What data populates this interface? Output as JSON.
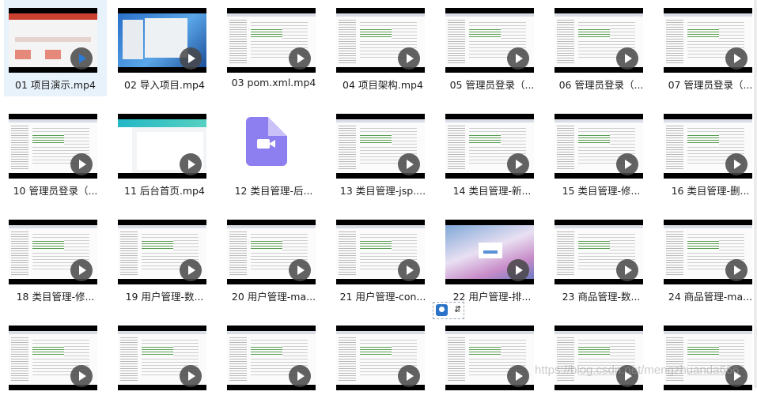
{
  "file_grid": {
    "items": [
      {
        "label": "01 项目演示.mp4",
        "thumb": "web",
        "selected": true
      },
      {
        "label": "02 导入项目.mp4",
        "thumb": "win"
      },
      {
        "label": "03 pom.xml.mp4",
        "thumb": "ide"
      },
      {
        "label": "04 项目架构.mp4",
        "thumb": "ide"
      },
      {
        "label": "05 管理员登录（...",
        "thumb": "ide"
      },
      {
        "label": "06 管理员登录（...",
        "thumb": "ide"
      },
      {
        "label": "07 管理员登录（...",
        "thumb": "ide"
      },
      {
        "label": "10 管理员登录（...",
        "thumb": "ide"
      },
      {
        "label": "11 后台首页.mp4",
        "thumb": "admin"
      },
      {
        "label": "12 类目管理-后...",
        "thumb": "file-icon"
      },
      {
        "label": "13 类目管理-jsp....",
        "thumb": "ide"
      },
      {
        "label": "14 类目管理-新...",
        "thumb": "ide"
      },
      {
        "label": "15 类目管理-修...",
        "thumb": "ide"
      },
      {
        "label": "16 类目管理-删...",
        "thumb": "ide"
      },
      {
        "label": "18 类目管理-修...",
        "thumb": "ide"
      },
      {
        "label": "19 用户管理-数...",
        "thumb": "ide"
      },
      {
        "label": "20 用户管理-ma...",
        "thumb": "ide"
      },
      {
        "label": "21 用户管理-con...",
        "thumb": "ide"
      },
      {
        "label": "22 用户管理-排...",
        "thumb": "login"
      },
      {
        "label": "23 商品管理-数...",
        "thumb": "ide"
      },
      {
        "label": "24 商品管理-ma...",
        "thumb": "ide"
      },
      {
        "label": "",
        "thumb": "ide"
      },
      {
        "label": "",
        "thumb": "ide"
      },
      {
        "label": "",
        "thumb": "ide"
      },
      {
        "label": "",
        "thumb": "ide"
      },
      {
        "label": "",
        "thumb": "ide"
      },
      {
        "label": "",
        "thumb": "ide"
      },
      {
        "label": "",
        "thumb": "ide"
      }
    ]
  },
  "watermark": {
    "text": "https://blog.csdn.net/mengzhuanda666"
  },
  "float_widget": {
    "sort_symbol": "⇵"
  },
  "colors": {
    "selected_bg": "#e8f2fb",
    "file_icon": "#8e7ff0"
  }
}
